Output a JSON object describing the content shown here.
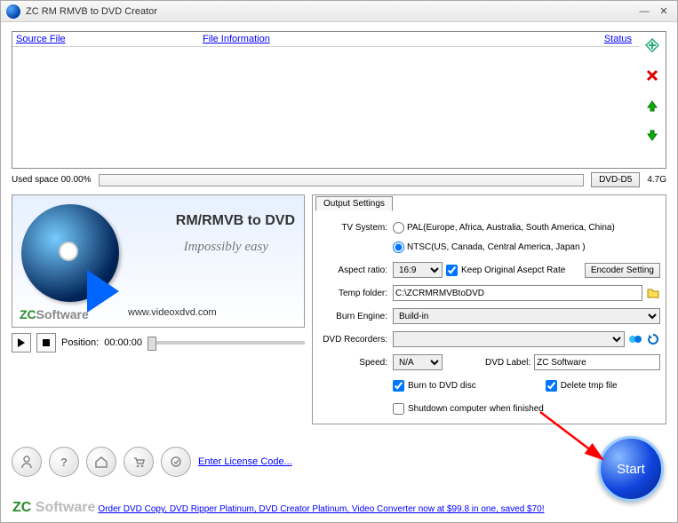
{
  "title": "ZC RM RMVB to DVD Creator",
  "grid": {
    "col_source": "Source File",
    "col_info": "File Information",
    "col_status": "Status"
  },
  "used": {
    "label": "Used space 00.00%",
    "cap_button": "DVD-D5",
    "cap_text": "4.7G"
  },
  "banner": {
    "line1": "RM/RMVB to DVD",
    "line2": "Impossibly easy",
    "brand_zc": "ZC",
    "brand_sw": "Software",
    "url": "www.videoxdvd.com"
  },
  "playback": {
    "pos_label": "Position:",
    "pos_value": "00:00:00"
  },
  "settings": {
    "tab": "Output Settings",
    "tv_label": "TV System:",
    "pal": "PAL(Europe, Africa, Australia, South America, China)",
    "ntsc": "NTSC(US, Canada, Central America, Japan )",
    "aspect_label": "Aspect ratio:",
    "aspect_value": "16:9",
    "keep_aspect": "Keep Original Asepct Rate",
    "encoder_btn": "Encoder Setting",
    "temp_label": "Temp folder:",
    "temp_value": "C:\\ZCRMRMVBtoDVD",
    "burn_engine_label": "Burn Engine:",
    "burn_engine_value": "Build-in",
    "recorders_label": "DVD Recorders:",
    "recorders_value": "",
    "speed_label": "Speed:",
    "speed_value": "N/A",
    "dvd_label_label": "DVD Label:",
    "dvd_label_value": "ZC Software",
    "burn_to_disc": "Burn to DVD disc",
    "delete_tmp": "Delete tmp file",
    "shutdown": "Shutdown computer when finished"
  },
  "bottom": {
    "enter_license": "Enter License Code...",
    "start": "Start"
  },
  "footer": {
    "brand_zc": "ZC",
    "brand_sw": "Software",
    "order": "Order DVD Copy, DVD Ripper Platinum, DVD Creator Platinum, Video Converter now at $99.8 in one, saved $70!"
  }
}
